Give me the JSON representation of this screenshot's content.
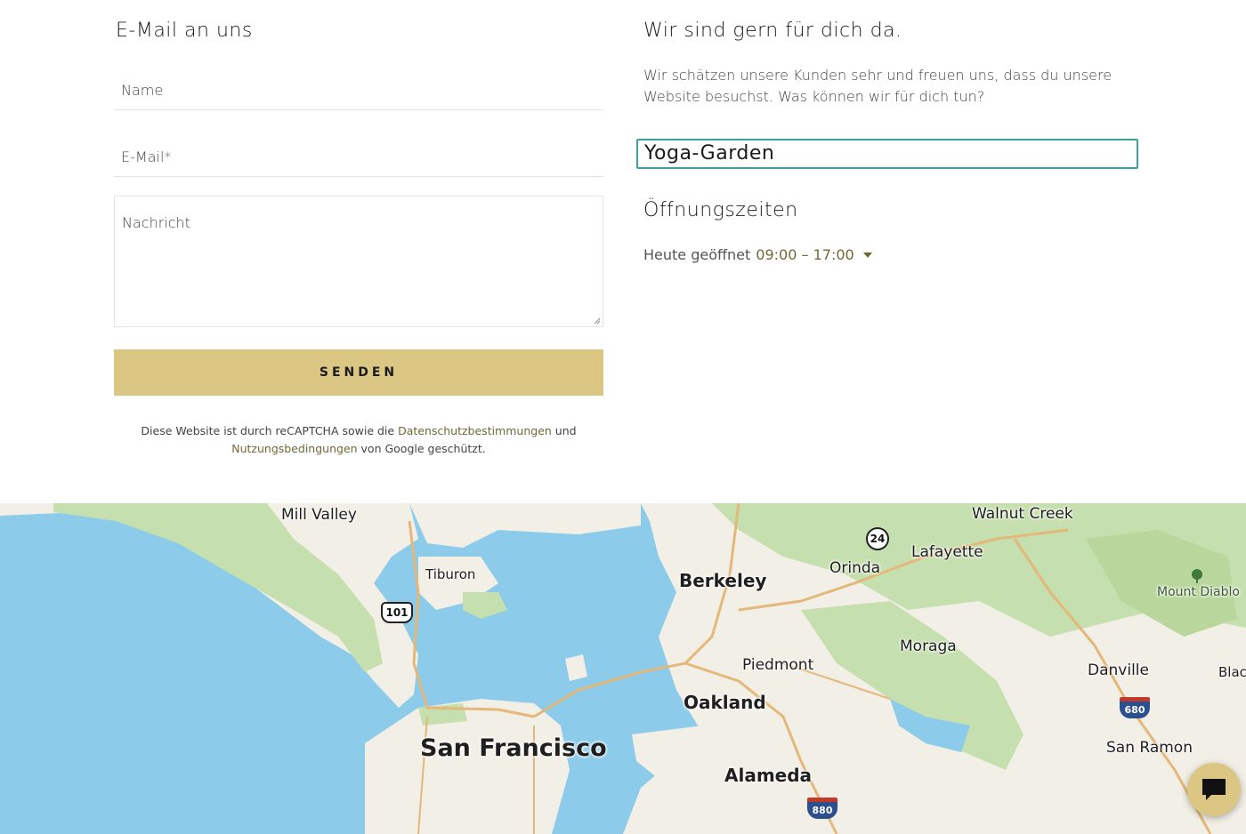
{
  "contact_form": {
    "title": "E-Mail an uns",
    "name_placeholder": "Name",
    "email_placeholder": "E-Mail*",
    "message_placeholder": "Nachricht",
    "submit_label": "SENDEN",
    "recaptcha": {
      "text_before": "Diese Website ist durch reCAPTCHA sowie die ",
      "privacy_link": "Datenschutzbestimmungen",
      "text_and": " und",
      "terms_link": "Nutzungsbedingungen",
      "text_after": " von Google geschützt."
    }
  },
  "info": {
    "title": "Wir sind gern für dich da.",
    "description": "Wir schätzen unsere Kunden sehr und freuen uns, dass du unsere Website besuchst. Was können wir für dich tun?",
    "business_name": "Yoga-Garden",
    "hours_title": "Öffnungszeiten",
    "hours_today_label": "Heute geöffnet",
    "hours_today_time": "09:00 – 17:00"
  },
  "map": {
    "labels": {
      "mill_valley": "Mill Valley",
      "tiburon": "Tiburon",
      "berkeley": "Berkeley",
      "orinda": "Orinda",
      "lafayette": "Lafayette",
      "walnut_creek": "Walnut Creek",
      "mount_diablo": "Mount Diablo",
      "moraga": "Moraga",
      "piedmont": "Piedmont",
      "oakland": "Oakland",
      "danville": "Danville",
      "blackhawk": "Blac",
      "san_francisco": "San Francisco",
      "alameda": "Alameda",
      "san_ramon": "San Ramon"
    },
    "shields": {
      "us101": "101",
      "ca24": "24",
      "i680": "680",
      "i880": "880"
    }
  },
  "colors": {
    "accent_gold": "#dbc683",
    "link_olive": "#6e6a37",
    "focus_teal": "#3aa39b",
    "water": "#8ccbe9",
    "land": "#f2efe6",
    "park": "#c6dfae"
  },
  "icons": {
    "chat": "chat-bubble-icon",
    "dropdown": "caret-down-icon",
    "mountain": "tree-icon"
  }
}
